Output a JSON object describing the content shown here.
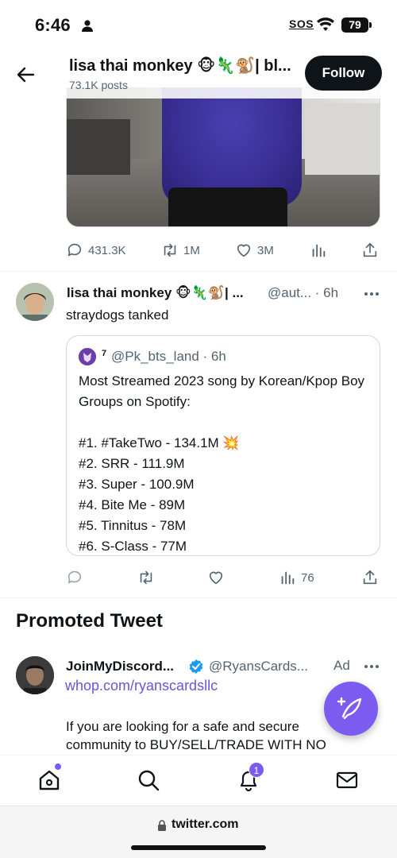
{
  "status_bar": {
    "time": "6:46",
    "sos": "SOS",
    "battery": "79"
  },
  "header": {
    "title": "lisa thai monkey 🐵🦎🐒| bl...",
    "posts": "73.1K posts",
    "follow_label": "Follow"
  },
  "prev_tweet_actions": {
    "replies": "431.3K",
    "retweets": "1M",
    "likes": "3M"
  },
  "tweet": {
    "name": "lisa thai monkey 🐵🦎🐒| ...",
    "handle_time": "@aut... · 6h",
    "text": "straydogs tanked",
    "quote": {
      "sup": "7",
      "handle_time": "@Pk_bts_land · 6h",
      "body": "Most Streamed 2023 song by Korean/Kpop Boy Groups on Spotify:\n\n#1. #TakeTwo - 134.1M 💥\n#2.  SRR - 111.9M\n#3. Super - 100.9M\n#4. Bite Me - 89M\n#5. Tinnitus - 78M\n#6. S-Class - 77M"
    },
    "views": "76"
  },
  "promoted": {
    "section_title": "Promoted Tweet",
    "name": "JoinMyDiscord...",
    "handle": "@RyansCards...",
    "ad_label": "Ad",
    "link": "whop.com/ryanscardsllc",
    "text": "If you are looking for a safe and secure community to BUY/SELL/TRADE WITH NO"
  },
  "bottom_nav": {
    "notifications_badge": "1"
  },
  "url_bar": {
    "url": "twitter.com"
  },
  "colors": {
    "accent": "#7c5cf0",
    "text": "#0f1419",
    "muted": "#536471",
    "link": "#6b54d8"
  },
  "icons": [
    "person-icon",
    "wifi-icon",
    "back-arrow-icon",
    "reply-icon",
    "retweet-icon",
    "like-icon",
    "views-icon",
    "share-icon",
    "more-icon",
    "verified-icon",
    "compose-icon",
    "home-icon",
    "search-icon",
    "bell-icon",
    "mail-icon",
    "lock-icon"
  ]
}
